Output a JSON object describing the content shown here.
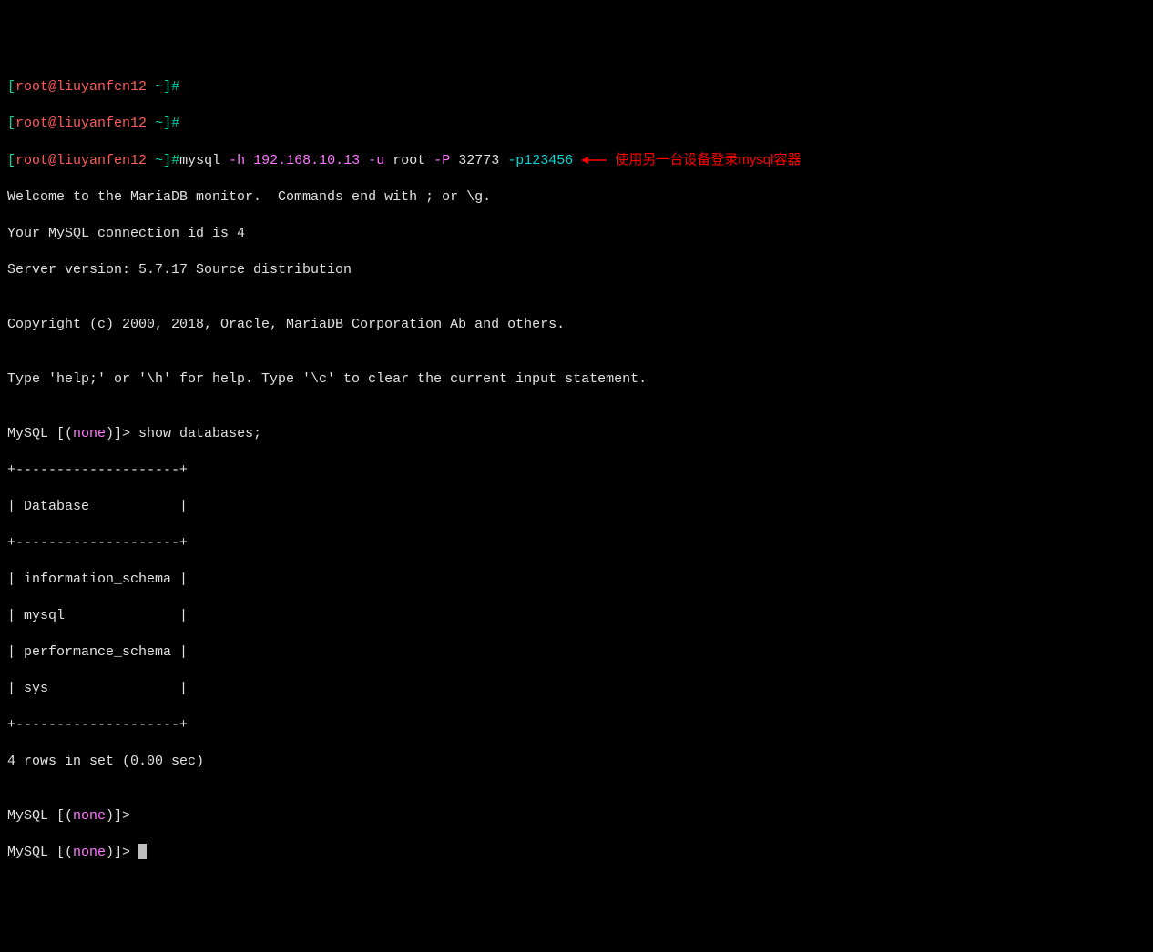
{
  "prompt": {
    "bracket_open": "[",
    "bracket_close": "]",
    "user": "root",
    "at": "@",
    "host": "liuyanfen12",
    "tilde": " ~",
    "hash": "#"
  },
  "command": {
    "mysql": "mysql ",
    "h_flag": "-h",
    "ip": " 192.168.10.13 ",
    "u_flag": "-u",
    "root": " root ",
    "P_flag": "-P",
    "port": " 32773 ",
    "p_flag": "-p",
    "password": "123456"
  },
  "annotation": {
    "text": "使用另一台设备登录mysql容器"
  },
  "output": {
    "welcome": "Welcome to the MariaDB monitor.  Commands end with ; or \\g.",
    "connection": "Your MySQL connection id is 4",
    "version": "Server version: 5.7.17 Source distribution",
    "blank": "",
    "copyright": "Copyright (c) 2000, 2018, Oracle, MariaDB Corporation Ab and others.",
    "help": "Type 'help;' or '\\h' for help. Type '\\c' to clear the current input statement."
  },
  "mysql_prompt": {
    "prefix": "MySQL [(",
    "none": "none",
    "suffix": ")]> "
  },
  "query": {
    "show_databases": "show databases;"
  },
  "table": {
    "sep": "+--------------------+",
    "header": "| Database           |",
    "rows": [
      "| information_schema |",
      "| mysql              |",
      "| performance_schema |",
      "| sys                |"
    ],
    "footer": "4 rows in set (0.00 sec)"
  }
}
